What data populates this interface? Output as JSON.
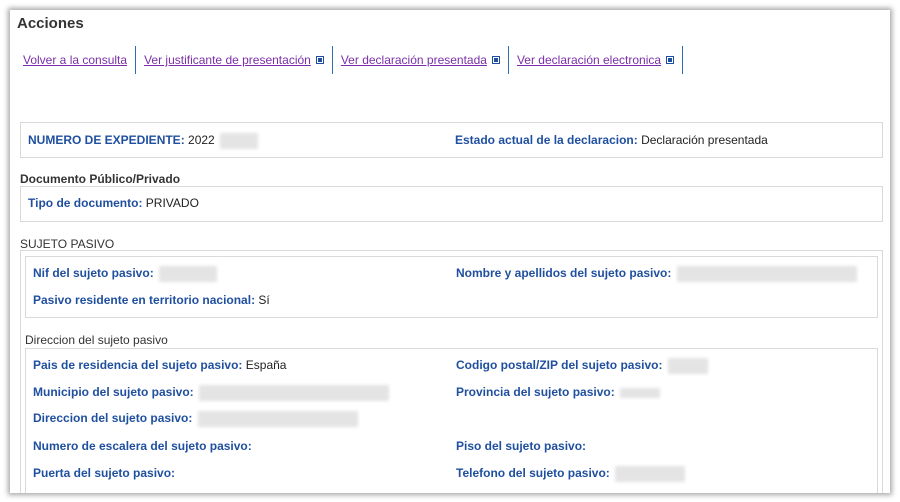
{
  "acciones": {
    "title": "Acciones",
    "links": [
      "Volver a la consulta",
      "Ver justificante de presentación",
      "Ver declaración presentada",
      "Ver declaración electronica"
    ]
  },
  "expediente": {
    "numero_label": "NUMERO DE EXPEDIENTE:",
    "numero_value": "2022",
    "estado_label": "Estado actual de la declaracion:",
    "estado_value": "Declaración presentada"
  },
  "documento": {
    "section_title": "Documento Público/Privado",
    "tipo_label": "Tipo de documento:",
    "tipo_value": "PRIVADO"
  },
  "sujeto": {
    "section_title": "SUJETO PASIVO",
    "nif_label": "Nif del sujeto pasivo:",
    "nombre_label": "Nombre y apellidos del sujeto pasivo:",
    "residente_label": "Pasivo residente en territorio nacional:",
    "residente_value": "Sí"
  },
  "direccion": {
    "section_title": "Direccion del sujeto pasivo",
    "pais_label": "Pais de residencia del sujeto pasivo:",
    "pais_value": "España",
    "codigo_label": "Codigo postal/ZIP del sujeto pasivo:",
    "municipio_label": "Municipio del sujeto pasivo:",
    "provincia_label": "Provincia del sujeto pasivo:",
    "direccion_label": "Direccion del sujeto pasivo:",
    "escalera_label": "Numero de escalera del sujeto pasivo:",
    "piso_label": "Piso del sujeto pasivo:",
    "puerta_label": "Puerta del sujeto pasivo:",
    "telefono_label": "Telefono del sujeto pasivo:"
  }
}
